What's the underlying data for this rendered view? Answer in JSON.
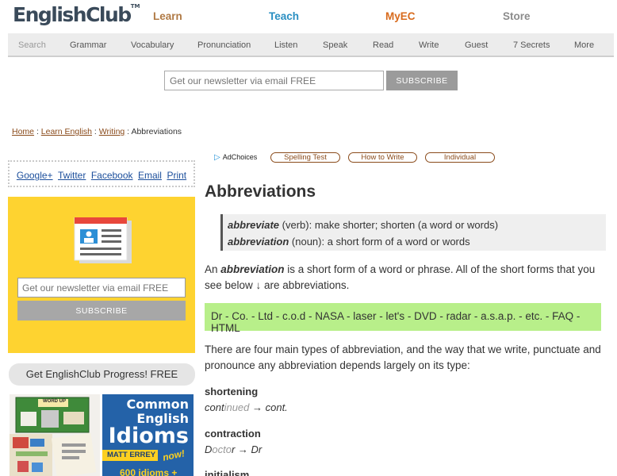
{
  "header": {
    "logo": "EnglishClub",
    "logo_tm": "TM",
    "nav": {
      "learn": "Learn",
      "teach": "Teach",
      "myec": "MyEC",
      "store": "Store"
    }
  },
  "menu": {
    "search": "Search",
    "grammar": "Grammar",
    "vocabulary": "Vocabulary",
    "pronunciation": "Pronunciation",
    "listen": "Listen",
    "speak": "Speak",
    "read": "Read",
    "write": "Write",
    "guest": "Guest",
    "secrets": "7 Secrets",
    "more": "More"
  },
  "newsletter": {
    "placeholder": "Get our newsletter via email FREE",
    "button": "SUBSCRIBE"
  },
  "breadcrumb": {
    "home": "Home",
    "learn_english": "Learn English",
    "writing": "Writing",
    "sep": ":",
    "current": "Abbreviations"
  },
  "share": {
    "googleplus": "Google+",
    "twitter": "Twitter",
    "facebook": "Facebook",
    "email": "Email",
    "print": "Print"
  },
  "sidebar": {
    "newsletter_placeholder": "Get our newsletter via email FREE",
    "newsletter_button": "SUBSCRIBE",
    "progress": "Get EnglishClub Progress! FREE",
    "book1_label": "WORD UP",
    "book2_line1": "Common",
    "book2_line2": "English",
    "book2_line3": "Idioms",
    "book2_author": "MATT ERREY",
    "book2_badge": "now!",
    "book2_count": "600 idioms +"
  },
  "ads": {
    "adchoices": "AdChoices",
    "pill1": "Spelling Test",
    "pill2": "How to Write",
    "pill3": "Individual"
  },
  "content": {
    "title": "Abbreviations",
    "def1_word": "abbreviate",
    "def1_rest": " (verb): make shorter; shorten (a word or words)",
    "def2_word": "abbreviation",
    "def2_rest": " (noun): a short form of a word or words",
    "intro_a": "An ",
    "intro_word": "abbreviation",
    "intro_b": " is a short form of a word or phrase. All of the short forms that you see below ↓ are abbreviations.",
    "examples_line": "Dr - Co. - Ltd - c.o.d - NASA - laser - let's - DVD - radar - a.s.a.p. - etc. - FAQ - HTML",
    "types_text": "There are four main types of abbreviation, and the way that we write, punctuate and pronounce any abbreviation depends largely on its type:",
    "shortening": "shortening",
    "shortening_ex_a": "cont",
    "shortening_ex_dim": "inued",
    "shortening_ex_b": " → cont.",
    "contraction": "contraction",
    "contraction_ex_a": "D",
    "contraction_ex_dim": "octo",
    "contraction_ex_b": "r → Dr",
    "initialism": "initialism"
  }
}
